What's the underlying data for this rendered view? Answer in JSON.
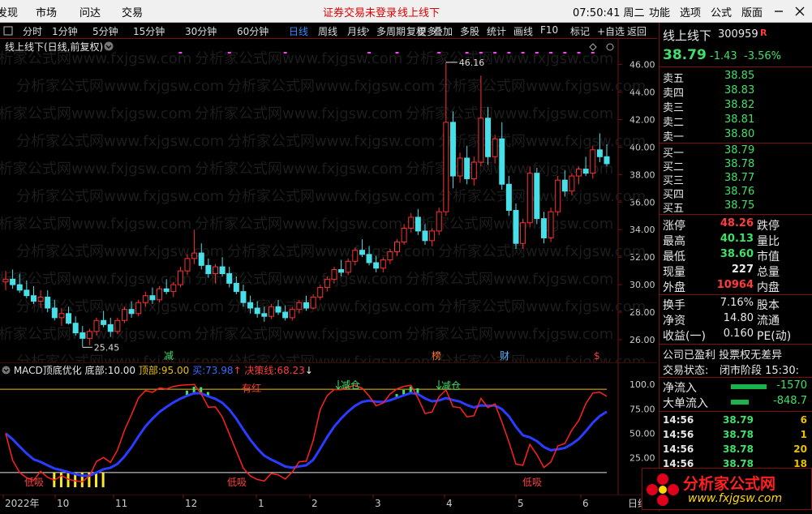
{
  "menu": {
    "discover": "发现",
    "market": "市场",
    "wenda": "问达",
    "trade": "交易",
    "warning": "证券交易未登录",
    "stock_title": "线上线下",
    "time": "07:50:41 周二",
    "func": "功能",
    "options": "选项",
    "formula": "公式",
    "layout": "版面"
  },
  "toolbar": {
    "periods": [
      "分时",
      "1分钟",
      "5分钟",
      "15分钟",
      "30分钟",
      "60分钟",
      "日线",
      "周线",
      "月线",
      "多周期",
      "更多"
    ],
    "active": "日线",
    "more_chevron": "›",
    "right": [
      "复权",
      "叠加",
      "多股",
      "统计",
      "画线",
      "F10",
      "标记",
      "+自选",
      "返回"
    ]
  },
  "chart": {
    "title": "线上线下(日线,前复权)",
    "price_axis": [
      "46.00",
      "44.00",
      "42.00",
      "40.00",
      "38.00",
      "36.00",
      "34.00",
      "32.00",
      "30.00",
      "28.00",
      "26.00"
    ],
    "price_min": 25.0,
    "price_max": 46.8,
    "high_label": "46.16",
    "low_label": "25.45",
    "events": [
      "减",
      "榜",
      "财",
      "$"
    ]
  },
  "ohlc": [
    [
      30.2,
      31.0,
      29.6,
      30.4
    ],
    [
      30.4,
      31.1,
      29.7,
      30.0
    ],
    [
      30.0,
      30.8,
      29.4,
      29.6
    ],
    [
      29.6,
      30.3,
      29.0,
      29.2
    ],
    [
      29.2,
      29.9,
      28.6,
      28.8
    ],
    [
      28.8,
      29.6,
      28.3,
      29.1
    ],
    [
      29.1,
      29.6,
      28.0,
      28.3
    ],
    [
      28.3,
      28.9,
      27.4,
      27.6
    ],
    [
      27.6,
      28.3,
      27.0,
      27.9
    ],
    [
      27.9,
      28.4,
      27.1,
      27.2
    ],
    [
      27.2,
      27.7,
      26.3,
      26.5
    ],
    [
      26.5,
      27.0,
      25.45,
      26.1
    ],
    [
      26.1,
      26.8,
      25.6,
      26.6
    ],
    [
      26.6,
      27.6,
      26.3,
      27.4
    ],
    [
      27.4,
      28.1,
      26.9,
      27.1
    ],
    [
      27.1,
      27.6,
      26.2,
      26.6
    ],
    [
      26.6,
      27.6,
      26.4,
      27.4
    ],
    [
      27.4,
      28.4,
      27.2,
      28.2
    ],
    [
      28.2,
      28.8,
      27.6,
      27.9
    ],
    [
      27.9,
      28.9,
      27.7,
      28.7
    ],
    [
      28.7,
      29.5,
      28.4,
      29.2
    ],
    [
      29.2,
      29.8,
      28.6,
      28.9
    ],
    [
      28.9,
      29.9,
      28.7,
      29.7
    ],
    [
      29.7,
      30.4,
      29.3,
      29.5
    ],
    [
      29.5,
      30.2,
      29.1,
      30.0
    ],
    [
      30.0,
      31.3,
      29.8,
      31.0
    ],
    [
      31.0,
      32.2,
      30.7,
      31.9
    ],
    [
      31.9,
      34.0,
      31.5,
      32.3
    ],
    [
      32.3,
      33.0,
      31.1,
      31.4
    ],
    [
      31.4,
      31.9,
      30.5,
      30.8
    ],
    [
      30.8,
      31.5,
      30.1,
      31.3
    ],
    [
      31.3,
      32.0,
      30.6,
      30.8
    ],
    [
      30.8,
      31.3,
      29.8,
      30.1
    ],
    [
      30.1,
      30.6,
      29.3,
      29.5
    ],
    [
      29.5,
      30.0,
      28.4,
      28.7
    ],
    [
      28.7,
      29.2,
      27.9,
      28.3
    ],
    [
      28.3,
      28.8,
      27.6,
      27.9
    ],
    [
      27.9,
      28.4,
      27.3,
      27.7
    ],
    [
      27.7,
      28.6,
      27.5,
      28.4
    ],
    [
      28.4,
      28.9,
      27.8,
      28.0
    ],
    [
      28.0,
      28.5,
      27.4,
      27.6
    ],
    [
      27.6,
      28.4,
      27.4,
      28.2
    ],
    [
      28.2,
      28.9,
      27.9,
      28.7
    ],
    [
      28.7,
      29.2,
      28.1,
      28.3
    ],
    [
      28.3,
      29.3,
      28.2,
      29.1
    ],
    [
      29.1,
      30.0,
      28.9,
      29.8
    ],
    [
      29.8,
      30.6,
      29.5,
      30.4
    ],
    [
      30.4,
      31.3,
      30.1,
      31.1
    ],
    [
      31.1,
      31.8,
      30.6,
      30.9
    ],
    [
      30.9,
      31.9,
      30.7,
      31.7
    ],
    [
      31.7,
      32.7,
      31.4,
      32.5
    ],
    [
      32.5,
      33.3,
      32.0,
      32.2
    ],
    [
      32.2,
      32.8,
      31.4,
      31.6
    ],
    [
      31.6,
      32.1,
      30.9,
      31.2
    ],
    [
      31.2,
      32.0,
      30.9,
      31.8
    ],
    [
      31.8,
      32.6,
      31.5,
      32.4
    ],
    [
      32.4,
      33.3,
      32.1,
      33.1
    ],
    [
      33.1,
      34.4,
      32.9,
      34.1
    ],
    [
      34.1,
      35.2,
      33.8,
      34.9
    ],
    [
      34.9,
      35.5,
      33.6,
      33.9
    ],
    [
      33.9,
      34.4,
      32.9,
      33.2
    ],
    [
      33.2,
      34.1,
      32.8,
      33.9
    ],
    [
      33.9,
      35.6,
      33.6,
      35.3
    ],
    [
      35.3,
      46.16,
      35.0,
      41.8
    ],
    [
      41.8,
      42.6,
      37.0,
      37.9
    ],
    [
      37.9,
      39.6,
      37.4,
      39.2
    ],
    [
      39.2,
      40.1,
      37.3,
      37.7
    ],
    [
      37.7,
      39.3,
      37.2,
      38.9
    ],
    [
      38.9,
      45.2,
      38.6,
      42.1
    ],
    [
      42.1,
      42.9,
      38.7,
      39.3
    ],
    [
      39.3,
      40.9,
      38.8,
      40.6
    ],
    [
      40.6,
      41.8,
      36.9,
      37.3
    ],
    [
      37.3,
      37.9,
      35.0,
      35.4
    ],
    [
      35.4,
      35.9,
      32.6,
      33.0
    ],
    [
      33.0,
      34.8,
      32.6,
      34.5
    ],
    [
      34.5,
      38.6,
      34.2,
      38.1
    ],
    [
      38.1,
      38.5,
      34.4,
      34.8
    ],
    [
      34.8,
      35.3,
      33.0,
      33.4
    ],
    [
      33.4,
      35.6,
      33.1,
      35.3
    ],
    [
      35.3,
      37.9,
      35.0,
      37.6
    ],
    [
      37.6,
      38.3,
      36.4,
      36.8
    ],
    [
      36.8,
      38.1,
      36.5,
      37.9
    ],
    [
      37.9,
      38.6,
      37.3,
      38.4
    ],
    [
      38.4,
      39.3,
      37.9,
      38.1
    ],
    [
      38.1,
      40.1,
      37.7,
      39.8
    ],
    [
      39.8,
      41.0,
      38.9,
      39.3
    ],
    [
      39.3,
      40.2,
      38.6,
      38.79
    ]
  ],
  "indicator": {
    "title": "MACD顶底优化",
    "bottom_label": "底部:",
    "bottom_val": "10.00",
    "top_label": "顶部:",
    "top_val": "95.00",
    "line2_label": "买:",
    "line2_val": "73.98",
    "up_arrow": "↑",
    "decide_label": "决策线:",
    "decide_val": "68.23",
    "down_arrow": "↓",
    "axis": [
      "100.0",
      "75.00",
      "50.00",
      "25.00"
    ],
    "annotations": {
      "youhong": "有红",
      "jiancang1": "减仓",
      "jiancang2": "减仓",
      "dixi1": "低吸",
      "dixi2": "低吸",
      "dixi3": "低吸"
    }
  },
  "xaxis": {
    "labels": [
      "2022年",
      "10",
      "11",
      "12",
      "1",
      "2",
      "3",
      "4",
      "5",
      "6"
    ],
    "daily_tag": "日线"
  },
  "quote": {
    "name": "线上线下",
    "code": "300959",
    "flag": "R",
    "price": "38.79",
    "change": "-1.43",
    "pct": "-3.56%",
    "asks": [
      {
        "l": "卖五",
        "p": "38.85"
      },
      {
        "l": "卖四",
        "p": "38.83"
      },
      {
        "l": "卖三",
        "p": "38.82"
      },
      {
        "l": "卖二",
        "p": "38.81"
      },
      {
        "l": "卖一",
        "p": "38.80"
      }
    ],
    "bids": [
      {
        "l": "买一",
        "p": "38.79"
      },
      {
        "l": "买二",
        "p": "38.78"
      },
      {
        "l": "买三",
        "p": "38.77"
      },
      {
        "l": "买四",
        "p": "38.76"
      },
      {
        "l": "买五",
        "p": "38.75"
      }
    ],
    "stats": [
      {
        "l": "涨停",
        "v": "48.26",
        "r": "跌停"
      },
      {
        "l": "最高",
        "v": "40.13",
        "r": "量比"
      },
      {
        "l": "最低",
        "v": "38.60",
        "r": "市值"
      },
      {
        "l": "现量",
        "v": "227",
        "r": "总量"
      },
      {
        "l": "外盘",
        "v": "10964",
        "r": "内盘"
      }
    ],
    "extra": [
      {
        "l": "换手",
        "v": "7.16%",
        "r": "股本"
      },
      {
        "l": "净资",
        "v": "14.80",
        "r": "流通"
      },
      {
        "l": "收益(一)",
        "v": "0.160",
        "r": "PE(动)"
      }
    ],
    "status1": "公司已盈利 投票权无差异",
    "status2": "交易状态:",
    "status2v": "闭市阶段 15:30:",
    "flow": [
      {
        "l": "净流入",
        "v": "-1570"
      },
      {
        "l": "大单流入",
        "v": "-848.7"
      }
    ],
    "ticks": [
      {
        "t": "14:56",
        "p": "38.79",
        "v": "6"
      },
      {
        "t": "14:56",
        "p": "38.78",
        "v": "1"
      },
      {
        "t": "14:56",
        "p": "38.78",
        "v": "20"
      },
      {
        "t": "14:56",
        "p": "38.78",
        "v": "18"
      }
    ]
  },
  "watermark": {
    "name": "分析家公式网",
    "url": "www.fxjgsw.com"
  }
}
